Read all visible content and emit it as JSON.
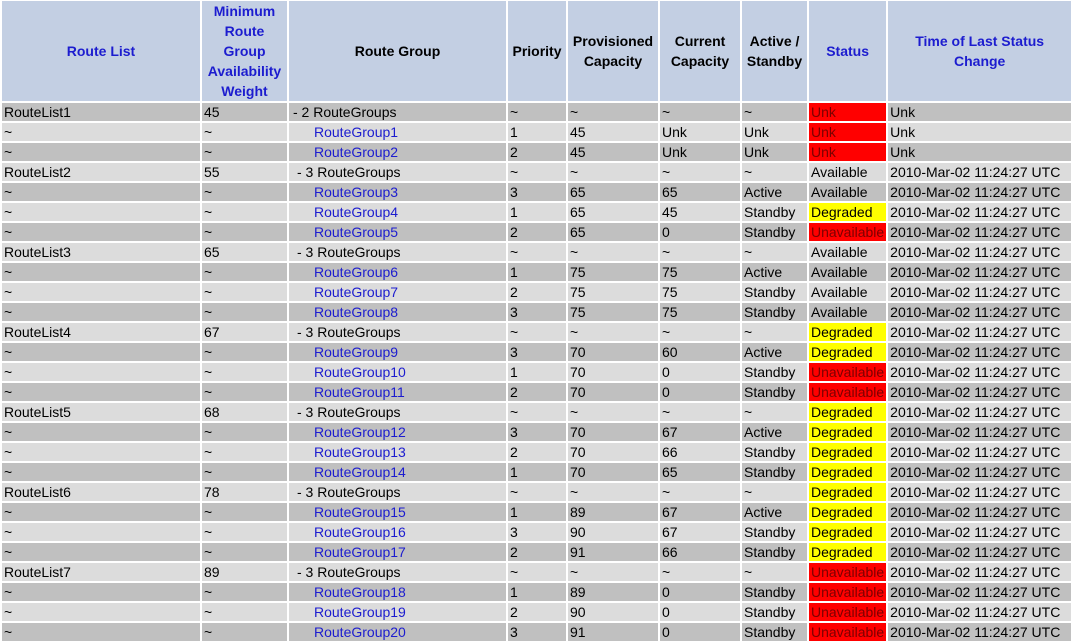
{
  "columns": [
    {
      "label": "Route List",
      "link": true
    },
    {
      "label": "Minimum Route Group Availability Weight",
      "link": true
    },
    {
      "label": "Route Group",
      "link": false
    },
    {
      "label": "Priority",
      "link": false
    },
    {
      "label": "Provisioned Capacity",
      "link": false
    },
    {
      "label": "Current Capacity",
      "link": false
    },
    {
      "label": "Active / Standby",
      "link": false
    },
    {
      "label": "Status",
      "link": true
    },
    {
      "label": "Time of Last Status Change",
      "link": true
    }
  ],
  "status_colors": {
    "Unk": "#ff0000",
    "Unavailable": "#ff0000",
    "Degraded": "#ffff00",
    "Available": "none"
  },
  "rows": [
    {
      "kind": "list",
      "route_list": "RouteList1",
      "weight": "45",
      "route_group": "- 2 RouteGroups",
      "priority": "~",
      "prov": "~",
      "cur": "~",
      "active": "~",
      "status": "Unk",
      "time": "Unk"
    },
    {
      "kind": "group",
      "route_list": "~",
      "weight": "~",
      "route_group": "RouteGroup1",
      "priority": "1",
      "prov": "45",
      "cur": "Unk",
      "active": "Unk",
      "status": "Unk",
      "time": "Unk"
    },
    {
      "kind": "group",
      "route_list": "~",
      "weight": "~",
      "route_group": "RouteGroup2",
      "priority": "2",
      "prov": "45",
      "cur": "Unk",
      "active": "Unk",
      "status": "Unk",
      "time": "Unk"
    },
    {
      "kind": "list",
      "route_list": "RouteList2",
      "weight": "55",
      "route_group": "- 3 RouteGroups",
      "priority": "~",
      "prov": "~",
      "cur": "~",
      "active": "~",
      "status": "Available",
      "time": "2010-Mar-02 11:24:27 UTC"
    },
    {
      "kind": "group",
      "route_list": "~",
      "weight": "~",
      "route_group": "RouteGroup3",
      "priority": "3",
      "prov": "65",
      "cur": "65",
      "active": "Active",
      "status": "Available",
      "time": "2010-Mar-02 11:24:27 UTC"
    },
    {
      "kind": "group",
      "route_list": "~",
      "weight": "~",
      "route_group": "RouteGroup4",
      "priority": "1",
      "prov": "65",
      "cur": "45",
      "active": "Standby",
      "status": "Degraded",
      "time": "2010-Mar-02 11:24:27 UTC"
    },
    {
      "kind": "group",
      "route_list": "~",
      "weight": "~",
      "route_group": "RouteGroup5",
      "priority": "2",
      "prov": "65",
      "cur": "0",
      "active": "Standby",
      "status": "Unavailable",
      "time": "2010-Mar-02 11:24:27 UTC"
    },
    {
      "kind": "list",
      "route_list": "RouteList3",
      "weight": "65",
      "route_group": "- 3 RouteGroups",
      "priority": "~",
      "prov": "~",
      "cur": "~",
      "active": "~",
      "status": "Available",
      "time": "2010-Mar-02 11:24:27 UTC"
    },
    {
      "kind": "group",
      "route_list": "~",
      "weight": "~",
      "route_group": "RouteGroup6",
      "priority": "1",
      "prov": "75",
      "cur": "75",
      "active": "Active",
      "status": "Available",
      "time": "2010-Mar-02 11:24:27 UTC"
    },
    {
      "kind": "group",
      "route_list": "~",
      "weight": "~",
      "route_group": "RouteGroup7",
      "priority": "2",
      "prov": "75",
      "cur": "75",
      "active": "Standby",
      "status": "Available",
      "time": "2010-Mar-02 11:24:27 UTC"
    },
    {
      "kind": "group",
      "route_list": "~",
      "weight": "~",
      "route_group": "RouteGroup8",
      "priority": "3",
      "prov": "75",
      "cur": "75",
      "active": "Standby",
      "status": "Available",
      "time": "2010-Mar-02 11:24:27 UTC"
    },
    {
      "kind": "list",
      "route_list": "RouteList4",
      "weight": "67",
      "route_group": "- 3 RouteGroups",
      "priority": "~",
      "prov": "~",
      "cur": "~",
      "active": "~",
      "status": "Degraded",
      "time": "2010-Mar-02 11:24:27 UTC"
    },
    {
      "kind": "group",
      "route_list": "~",
      "weight": "~",
      "route_group": "RouteGroup9",
      "priority": "3",
      "prov": "70",
      "cur": "60",
      "active": "Active",
      "status": "Degraded",
      "time": "2010-Mar-02 11:24:27 UTC"
    },
    {
      "kind": "group",
      "route_list": "~",
      "weight": "~",
      "route_group": "RouteGroup10",
      "priority": "1",
      "prov": "70",
      "cur": "0",
      "active": "Standby",
      "status": "Unavailable",
      "time": "2010-Mar-02 11:24:27 UTC"
    },
    {
      "kind": "group",
      "route_list": "~",
      "weight": "~",
      "route_group": "RouteGroup11",
      "priority": "2",
      "prov": "70",
      "cur": "0",
      "active": "Standby",
      "status": "Unavailable",
      "time": "2010-Mar-02 11:24:27 UTC"
    },
    {
      "kind": "list",
      "route_list": "RouteList5",
      "weight": "68",
      "route_group": "- 3 RouteGroups",
      "priority": "~",
      "prov": "~",
      "cur": "~",
      "active": "~",
      "status": "Degraded",
      "time": "2010-Mar-02 11:24:27 UTC"
    },
    {
      "kind": "group",
      "route_list": "~",
      "weight": "~",
      "route_group": "RouteGroup12",
      "priority": "3",
      "prov": "70",
      "cur": "67",
      "active": "Active",
      "status": "Degraded",
      "time": "2010-Mar-02 11:24:27 UTC"
    },
    {
      "kind": "group",
      "route_list": "~",
      "weight": "~",
      "route_group": "RouteGroup13",
      "priority": "2",
      "prov": "70",
      "cur": "66",
      "active": "Standby",
      "status": "Degraded",
      "time": "2010-Mar-02 11:24:27 UTC"
    },
    {
      "kind": "group",
      "route_list": "~",
      "weight": "~",
      "route_group": "RouteGroup14",
      "priority": "1",
      "prov": "70",
      "cur": "65",
      "active": "Standby",
      "status": "Degraded",
      "time": "2010-Mar-02 11:24:27 UTC"
    },
    {
      "kind": "list",
      "route_list": "RouteList6",
      "weight": "78",
      "route_group": "- 3 RouteGroups",
      "priority": "~",
      "prov": "~",
      "cur": "~",
      "active": "~",
      "status": "Degraded",
      "time": "2010-Mar-02 11:24:27 UTC"
    },
    {
      "kind": "group",
      "route_list": "~",
      "weight": "~",
      "route_group": "RouteGroup15",
      "priority": "1",
      "prov": "89",
      "cur": "67",
      "active": "Active",
      "status": "Degraded",
      "time": "2010-Mar-02 11:24:27 UTC"
    },
    {
      "kind": "group",
      "route_list": "~",
      "weight": "~",
      "route_group": "RouteGroup16",
      "priority": "3",
      "prov": "90",
      "cur": "67",
      "active": "Standby",
      "status": "Degraded",
      "time": "2010-Mar-02 11:24:27 UTC"
    },
    {
      "kind": "group",
      "route_list": "~",
      "weight": "~",
      "route_group": "RouteGroup17",
      "priority": "2",
      "prov": "91",
      "cur": "66",
      "active": "Standby",
      "status": "Degraded",
      "time": "2010-Mar-02 11:24:27 UTC"
    },
    {
      "kind": "list",
      "route_list": "RouteList7",
      "weight": "89",
      "route_group": "- 3 RouteGroups",
      "priority": "~",
      "prov": "~",
      "cur": "~",
      "active": "~",
      "status": "Unavailable",
      "time": "2010-Mar-02 11:24:27 UTC"
    },
    {
      "kind": "group",
      "route_list": "~",
      "weight": "~",
      "route_group": "RouteGroup18",
      "priority": "1",
      "prov": "89",
      "cur": "0",
      "active": "Standby",
      "status": "Unavailable",
      "time": "2010-Mar-02 11:24:27 UTC"
    },
    {
      "kind": "group",
      "route_list": "~",
      "weight": "~",
      "route_group": "RouteGroup19",
      "priority": "2",
      "prov": "90",
      "cur": "0",
      "active": "Standby",
      "status": "Unavailable",
      "time": "2010-Mar-02 11:24:27 UTC"
    },
    {
      "kind": "group",
      "route_list": "~",
      "weight": "~",
      "route_group": "RouteGroup20",
      "priority": "3",
      "prov": "91",
      "cur": "0",
      "active": "Standby",
      "status": "Unavailable",
      "time": "2010-Mar-02 11:24:27 UTC"
    }
  ]
}
